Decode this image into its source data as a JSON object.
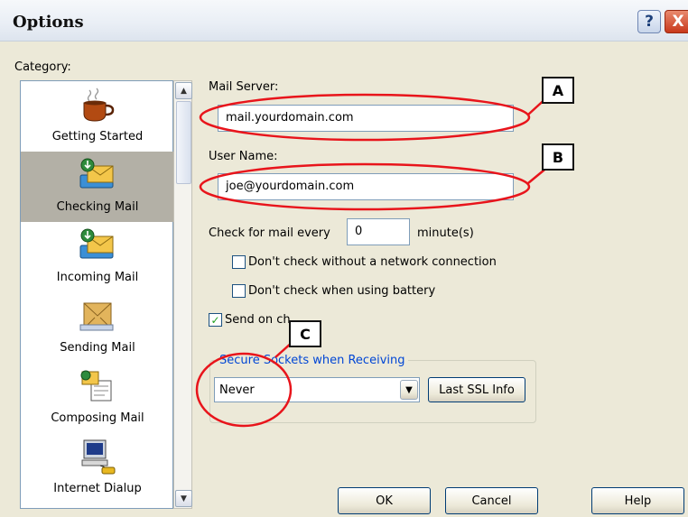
{
  "window": {
    "title": "Options",
    "help_glyph": "?",
    "close_glyph": "X"
  },
  "category": {
    "label": "Category:",
    "items": [
      {
        "label": "Getting Started",
        "icon": "coffee-cup-icon",
        "selected": false
      },
      {
        "label": "Checking Mail",
        "icon": "mail-check-icon",
        "selected": true
      },
      {
        "label": "Incoming Mail",
        "icon": "mail-incoming-icon",
        "selected": false
      },
      {
        "label": "Sending Mail",
        "icon": "mail-sending-icon",
        "selected": false
      },
      {
        "label": "Composing Mail",
        "icon": "composing-mail-icon",
        "selected": false
      },
      {
        "label": "Internet Dialup",
        "icon": "computer-dialup-icon",
        "selected": false
      }
    ]
  },
  "mail_server": {
    "label": "Mail Server:",
    "value": "mail.yourdomain.com"
  },
  "user_name": {
    "label": "User Name:",
    "value": "joe@yourdomain.com"
  },
  "check_interval": {
    "label": "Check for mail every",
    "value": "0",
    "unit": "minute(s)"
  },
  "options": {
    "no_network": {
      "label": "Don't check without a network connection",
      "checked": false
    },
    "battery": {
      "label": "Don't check when using battery",
      "checked": false
    },
    "send_on_check": {
      "label": "Send on ch",
      "checked": true,
      "check_glyph": "✓"
    }
  },
  "ssl": {
    "group_title": "Secure Sockets when Receiving",
    "selected": "Never",
    "info_button": "Last SSL Info"
  },
  "buttons": {
    "ok": "OK",
    "cancel": "Cancel",
    "help": "Help"
  },
  "callouts": {
    "a": "A",
    "b": "B",
    "c": "C"
  },
  "colors": {
    "callout_red": "#e8141b",
    "accent_blue": "#0046d5",
    "selection": "#b3b0a6"
  }
}
